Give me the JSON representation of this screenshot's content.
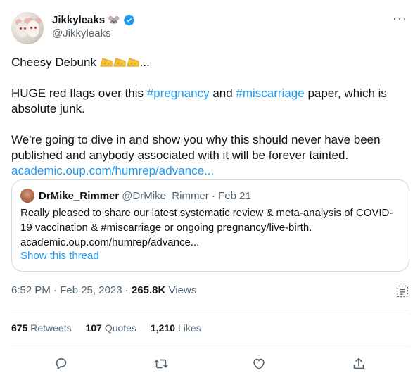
{
  "author": {
    "name": "Jikkyleaks",
    "emoji": "🐭",
    "handle": "@Jikkyleaks"
  },
  "more_label": "···",
  "tweet": {
    "line1": "Cheesy Debunk",
    "line1_suffix": "...",
    "para2_a": "HUGE red flags over this ",
    "tag1": "#pregnancy",
    "para2_b": " and ",
    "tag2": "#miscarriage",
    "para2_c": " paper, which is absolute junk.",
    "para3": "We're going to dive in and show you why this should never have been published and anybody associated with it will be forever tainted.",
    "link": "academic.oup.com/humrep/advance..."
  },
  "quote": {
    "name": "DrMike_Rimmer",
    "handle": "@DrMike_Rimmer · Feb 21",
    "body": "Really pleased to share our latest systematic review & meta-analysis of COVID-19 vaccination & #miscarriage or ongoing pregnancy/live-birth. academic.oup.com/humrep/advance...",
    "show_thread": "Show this thread"
  },
  "meta": {
    "datetime": "6:52 PM · Feb 25, 2023 · ",
    "views_count": "265.8K",
    "views_label": " Views"
  },
  "stats": {
    "retweets_count": "675",
    "retweets_label": "Retweets",
    "quotes_count": "107",
    "quotes_label": "Quotes",
    "likes_count": "1,210",
    "likes_label": "Likes"
  },
  "colors": {
    "accent": "#1d9bf0",
    "text": "#0f1419",
    "secondary": "#536471",
    "border": "#cfd9de"
  },
  "icons": [
    "verified-badge-icon",
    "more-icon",
    "analytics-icon",
    "reply-icon",
    "retweet-icon",
    "like-icon",
    "share-icon"
  ]
}
